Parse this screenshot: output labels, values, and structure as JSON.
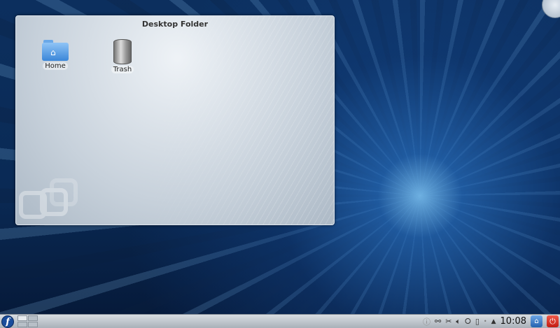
{
  "folder": {
    "title": "Desktop Folder",
    "icons": [
      {
        "label": "Home",
        "icon": "folder-home-icon"
      },
      {
        "label": "Trash",
        "icon": "trash-icon"
      }
    ]
  },
  "panel": {
    "launcher_icon": "fedora-icon",
    "tray_icons": [
      "info-icon",
      "network-icon",
      "klipper-scissors-icon",
      "volume-icon",
      "usb-icon",
      "battery-icon",
      "notification-dot-icon",
      "expand-tray-arrow-icon"
    ],
    "clock": "10:08",
    "lock_icon": "lock-screen-icon",
    "power_icon": "power-icon"
  }
}
